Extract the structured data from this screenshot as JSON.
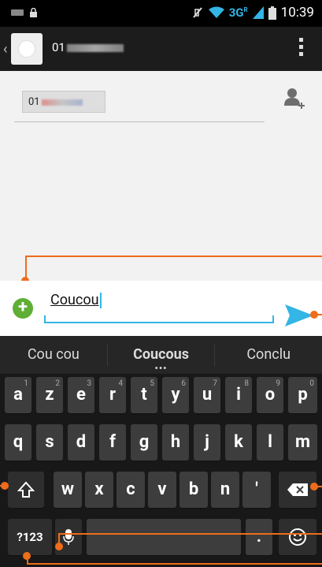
{
  "status_bar": {
    "network": "3G",
    "network_sup": "R",
    "time": "10:39"
  },
  "action_bar": {
    "contact_prefix": "01",
    "back_icon": "chevron-left-icon",
    "menu_icon": "overflow-menu-icon"
  },
  "recipients": {
    "chip_prefix": "01",
    "add_contact_icon": "add-contact-icon"
  },
  "message": {
    "text": "Coucou",
    "attach_icon": "add-attachment-icon",
    "send_icon": "send-icon"
  },
  "suggestions": [
    "Cou cou",
    "Coucous",
    "Conclu"
  ],
  "keyboard": {
    "row1": [
      {
        "label": "a",
        "hint": "1"
      },
      {
        "label": "z",
        "hint": "2"
      },
      {
        "label": "e",
        "hint": "3"
      },
      {
        "label": "r",
        "hint": "4"
      },
      {
        "label": "t",
        "hint": "5"
      },
      {
        "label": "y",
        "hint": "6"
      },
      {
        "label": "u",
        "hint": "7"
      },
      {
        "label": "i",
        "hint": "8"
      },
      {
        "label": "o",
        "hint": "9"
      },
      {
        "label": "p",
        "hint": "0"
      }
    ],
    "row2": [
      "q",
      "s",
      "d",
      "f",
      "g",
      "h",
      "j",
      "k",
      "l",
      "m"
    ],
    "row3": [
      "w",
      "x",
      "c",
      "v",
      "b",
      "n",
      "'"
    ],
    "symbols_label": "?123",
    "period_label": ".",
    "shift_icon": "shift-icon",
    "delete_icon": "backspace-icon",
    "mic_icon": "microphone-icon",
    "emoji_icon": "emoji-icon"
  },
  "colors": {
    "accent": "#33b5e5",
    "callout": "#ef6c1a",
    "attach": "#5fae35"
  }
}
